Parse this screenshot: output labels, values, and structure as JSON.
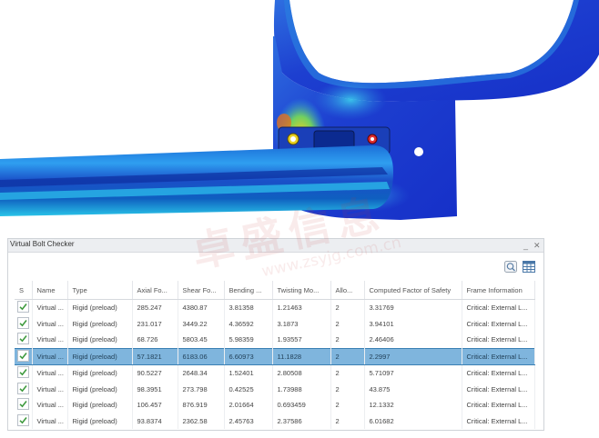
{
  "panel": {
    "title": "Virtual Bolt Checker",
    "minimize_glyph": "_",
    "close_glyph": "✕"
  },
  "toolbar": {
    "icons": [
      "zoom-fit-icon",
      "table-settings-icon"
    ]
  },
  "table": {
    "columns": [
      "S",
      "Name",
      "Type",
      "Axial Fo...",
      "Shear Fo...",
      "Bending ...",
      "Twisting Mo...",
      "Allo...",
      "Computed Factor of Safety",
      "Frame Information"
    ],
    "rows": [
      {
        "checked": true,
        "name": "Virtual ...",
        "type": "Rigid (preload)",
        "axial": "285.247",
        "shear": "4380.87",
        "bending": "3.81358",
        "twisting": "1.21463",
        "allowable": "2",
        "factor": "3.31769",
        "frame": "Critical: External L..."
      },
      {
        "checked": true,
        "name": "Virtual ...",
        "type": "Rigid (preload)",
        "axial": "231.017",
        "shear": "3449.22",
        "bending": "4.36592",
        "twisting": "3.1873",
        "allowable": "2",
        "factor": "3.94101",
        "frame": "Critical: External L..."
      },
      {
        "checked": true,
        "name": "Virtual ...",
        "type": "Rigid (preload)",
        "axial": "68.726",
        "shear": "5803.45",
        "bending": "5.98359",
        "twisting": "1.93557",
        "allowable": "2",
        "factor": "2.46406",
        "frame": "Critical: External L..."
      },
      {
        "checked": true,
        "name": "Virtual ...",
        "type": "Rigid (preload)",
        "axial": "57.1821",
        "shear": "6183.06",
        "bending": "6.60973",
        "twisting": "11.1828",
        "allowable": "2",
        "factor": "2.2997",
        "frame": "Critical: External L...",
        "selected": true
      },
      {
        "checked": true,
        "name": "Virtual ...",
        "type": "Rigid (preload)",
        "axial": "90.5227",
        "shear": "2648.34",
        "bending": "1.52401",
        "twisting": "2.80508",
        "allowable": "2",
        "factor": "5.71097",
        "frame": "Critical: External L..."
      },
      {
        "checked": true,
        "name": "Virtual ...",
        "type": "Rigid (preload)",
        "axial": "98.3951",
        "shear": "273.798",
        "bending": "0.42525",
        "twisting": "1.73988",
        "allowable": "2",
        "factor": "43.875",
        "frame": "Critical: External L..."
      },
      {
        "checked": true,
        "name": "Virtual ...",
        "type": "Rigid (preload)",
        "axial": "106.457",
        "shear": "876.919",
        "bending": "2.01664",
        "twisting": "0.693459",
        "allowable": "2",
        "factor": "12.1332",
        "frame": "Critical: External L..."
      },
      {
        "checked": true,
        "name": "Virtual ...",
        "type": "Rigid (preload)",
        "axial": "93.8374",
        "shear": "2362.58",
        "bending": "2.45763",
        "twisting": "2.37586",
        "allowable": "2",
        "factor": "6.01682",
        "frame": "Critical: External L..."
      }
    ]
  },
  "watermark": {
    "text_cn": "卓盛信息",
    "text_url": "www.zsyjg.com.cn"
  },
  "colors": {
    "selected_row": "#7fb5dd",
    "check_mark": "#3e9a3e",
    "stress_low": "#1030c8",
    "stress_mid": "#2aa0e0",
    "stress_high": "#e02010"
  }
}
